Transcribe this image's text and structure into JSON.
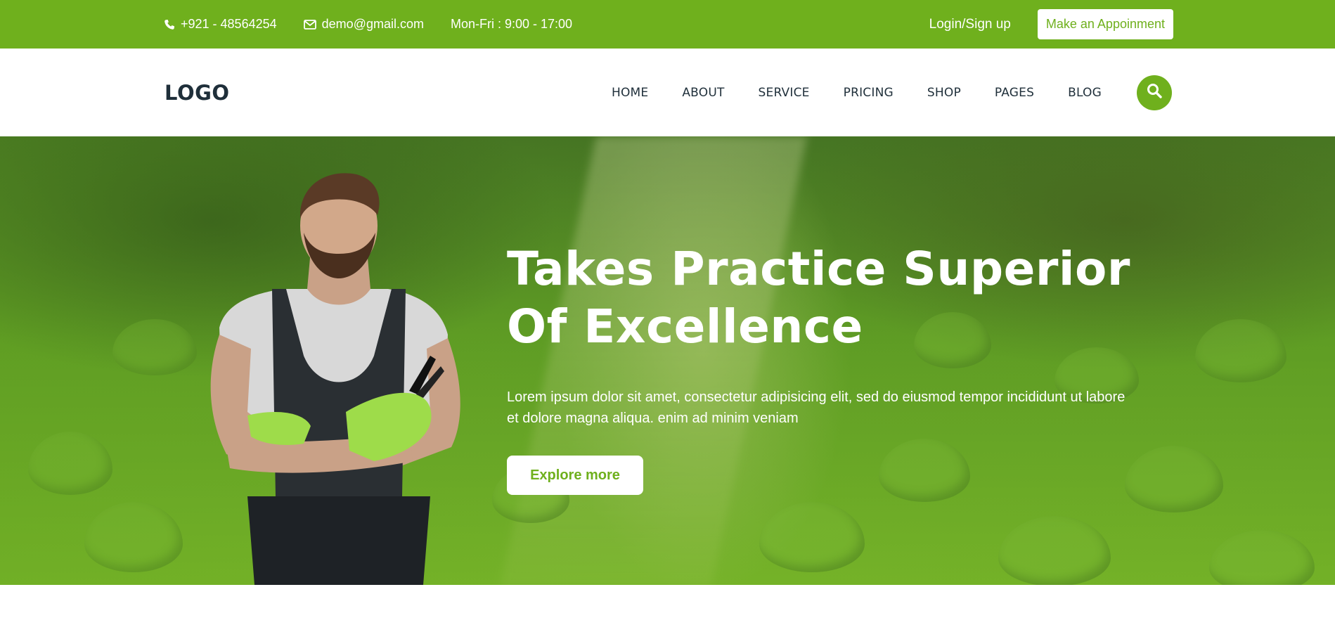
{
  "topbar": {
    "phone": "+921 - 48564254",
    "email": "demo@gmail.com",
    "hours": "Mon-Fri : 9:00 - 17:00",
    "login_label": "Login/Sign up",
    "appointment_label": "Make an Appoinment"
  },
  "navbar": {
    "logo": "LOGO",
    "items": [
      "HOME",
      "ABOUT",
      "SERVICE",
      "PRICING",
      "SHOP",
      "PAGES",
      "BLOG"
    ]
  },
  "hero": {
    "title_line1": "Takes Practice Superior",
    "title_line2": "Of Excellence",
    "text_line1": "Lorem ipsum dolor sit amet, consectetur adipisicing elit, sed do eiusmod tempor incididunt ut labore",
    "text_line2": "et dolore magna aliqua. enim ad minim veniam",
    "cta_label": "Explore more"
  },
  "colors": {
    "brand_green": "#6fb01d",
    "dark_text": "#1f2f3a",
    "white": "#ffffff"
  },
  "icons": {
    "phone": "phone-icon",
    "email": "envelope-icon",
    "search": "search-icon"
  }
}
